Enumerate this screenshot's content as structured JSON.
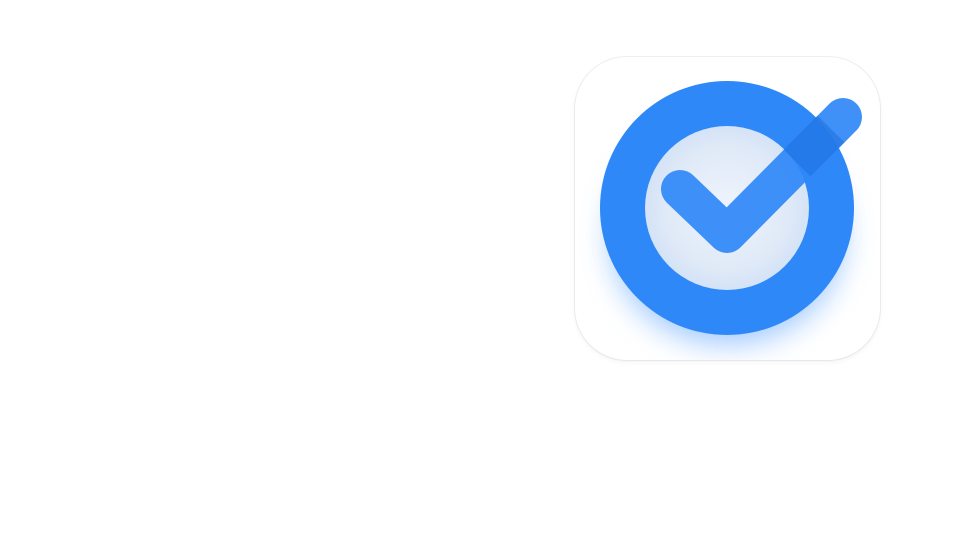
{
  "icon": {
    "name": "check-circle-app-icon",
    "colors": {
      "ring": "#2f88f7",
      "ring_glow": "#5aa2ff",
      "inner_fill": "#dfe9f7",
      "check_mark": "#2f88f7",
      "check_overlap": "#1f6fdc",
      "tile_background": "#ffffff"
    }
  }
}
